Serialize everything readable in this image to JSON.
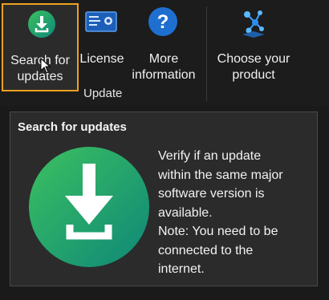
{
  "ribbon": {
    "buttons": {
      "search": {
        "line1": "Search for",
        "line2": "updates",
        "icon": "download-icon"
      },
      "license": {
        "line1": "License",
        "icon": "license-icon"
      },
      "more_info": {
        "line1": "More",
        "line2": "information",
        "icon": "help-icon"
      },
      "product": {
        "line1": "Choose your",
        "line2": "product",
        "icon": "product-network-icon"
      }
    },
    "group_label": "Update"
  },
  "tooltip": {
    "title": "Search for updates",
    "description_lines": [
      "Verify if an update",
      "within the same major",
      "software version is",
      "available.",
      "Note: You need to be",
      "connected to the",
      "internet."
    ],
    "icon": "download-icon"
  },
  "colors": {
    "highlight_border": "#f0a020",
    "icon_green": "#2fae5a",
    "icon_teal": "#0f8a80",
    "help_blue": "#1e6fd0"
  }
}
